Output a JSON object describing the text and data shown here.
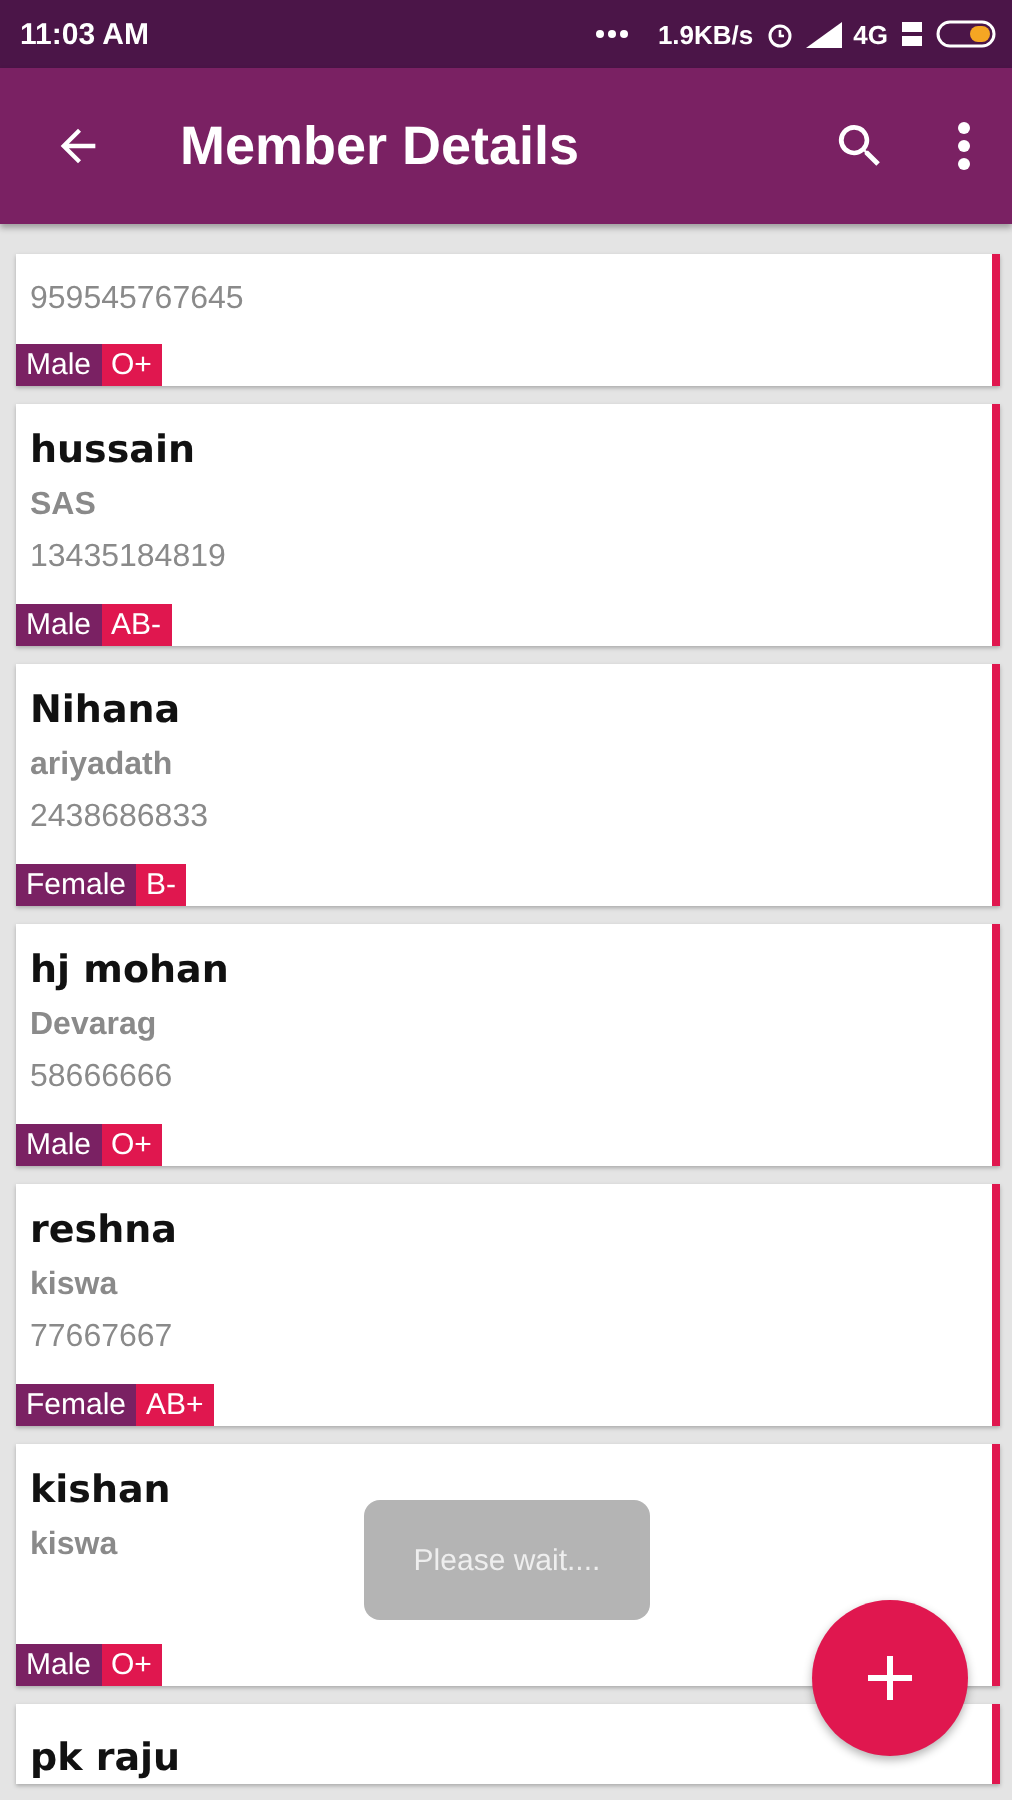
{
  "status_bar": {
    "time": "11:03 AM",
    "speed": "1.9KB/s",
    "network": "4G"
  },
  "app_bar": {
    "title": "Member Details"
  },
  "members": [
    {
      "kind": "partial",
      "phone": "959545767645",
      "gender": "Male",
      "blood_group": "O+"
    },
    {
      "kind": "full",
      "name": "hussain",
      "family": "SAS",
      "phone": "13435184819",
      "gender": "Male",
      "blood_group": "AB-"
    },
    {
      "kind": "full",
      "name": "Nihana",
      "family": "ariyadath",
      "phone": "2438686833",
      "gender": "Female",
      "blood_group": "B-"
    },
    {
      "kind": "full",
      "name": "hj mohan",
      "family": "Devarag",
      "phone": "58666666",
      "gender": "Male",
      "blood_group": "O+"
    },
    {
      "kind": "full",
      "name": "reshna",
      "family": "kiswa",
      "phone": "77667667",
      "gender": "Female",
      "blood_group": "AB+"
    },
    {
      "kind": "full",
      "name": "kishan",
      "family": "kiswa",
      "gender": "Male",
      "blood_group": "O+"
    },
    {
      "kind": "cut",
      "name": "pk raju"
    }
  ],
  "toast": "Please wait...."
}
